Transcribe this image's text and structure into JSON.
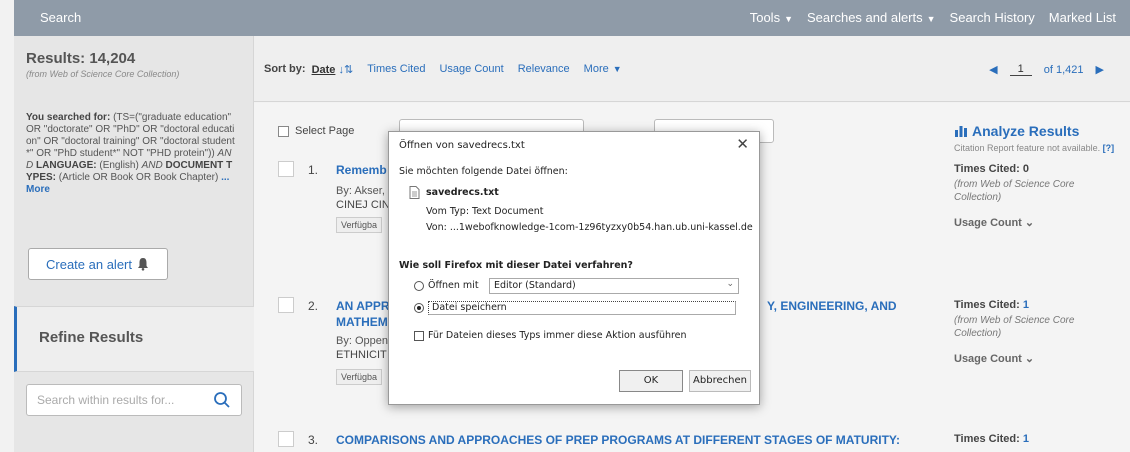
{
  "nav": {
    "left": "Search",
    "tools": "Tools",
    "searches_alerts": "Searches and alerts",
    "history": "Search History",
    "marked": "Marked List"
  },
  "sidebar": {
    "results_title": "Results: 14,204",
    "results_sub": "(from Web of Science Core Collection)",
    "searched_label": "You searched for:",
    "searched_query": "(TS=(\"graduate education\" OR \"doctorate\" OR \"PhD\" OR \"doctoral education\" OR \"doctoral training\" OR \"doctoral student*\" OR \"PhD student*\" NOT \"PHD protein\"))",
    "and1": "AND",
    "lang_label": "LANGUAGE:",
    "lang_value": "(English)",
    "and2": "AND",
    "doctype_label": "DOCUMENT TYPES:",
    "doctype_value": "(Article OR Book OR Book Chapter)",
    "more": "...More",
    "create_alert": "Create an alert",
    "refine": "Refine Results",
    "search_within_placeholder": "Search within results for..."
  },
  "sortbar": {
    "label": "Sort by:",
    "date": "Date",
    "times_cited": "Times Cited",
    "usage": "Usage Count",
    "relevance": "Relevance",
    "more": "More",
    "page": "1",
    "of": "of 1,421"
  },
  "main": {
    "select_page": "Select Page",
    "analyze": "Analyze Results",
    "analyze_note": "Citation Report feature not available.",
    "analyze_help": "[?]",
    "records": [
      {
        "num": "1.",
        "title": "Rememb",
        "by": "By: Akser,",
        "src": "CINEJ CIN",
        "avail": "Verfügba",
        "times_cited_label": "Times Cited:",
        "times_cited": "0",
        "from": "(from Web of Science Core Collection)",
        "usage": "Usage Count"
      },
      {
        "num": "2.",
        "title_a": "AN APPRO",
        "title_b": "Y, ENGINEERING, AND",
        "title_c": "MATHEMA",
        "by": "By: Oppen",
        "src": "ETHNICIT",
        "avail": "Verfügba",
        "times_cited_label": "Times Cited:",
        "times_cited": "1",
        "from": "(from Web of Science Core Collection)",
        "usage": "Usage Count"
      },
      {
        "num": "3.",
        "title": "COMPARISONS AND APPROACHES OF PREP PROGRAMS AT DIFFERENT STAGES OF MATURITY:",
        "times_cited_label": "Times Cited:",
        "times_cited": "1"
      }
    ]
  },
  "dialog": {
    "title": "Öffnen von savedrecs.txt",
    "close": "✕",
    "prompt": "Sie möchten folgende Datei öffnen:",
    "filename": "savedrecs.txt",
    "type": "Vom Typ: Text Document",
    "from": "Von: ...1webofknowledge-1com-1z96tyzxy0b54.han.ub.uni-kassel.de",
    "question": "Wie soll Firefox mit dieser Datei verfahren?",
    "open_with": "Öffnen mit",
    "app": "Editor (Standard)",
    "save_file": "Datei speichern",
    "always": "Für Dateien dieses Typs immer diese Aktion ausführen",
    "ok": "OK",
    "cancel": "Abbrechen"
  }
}
